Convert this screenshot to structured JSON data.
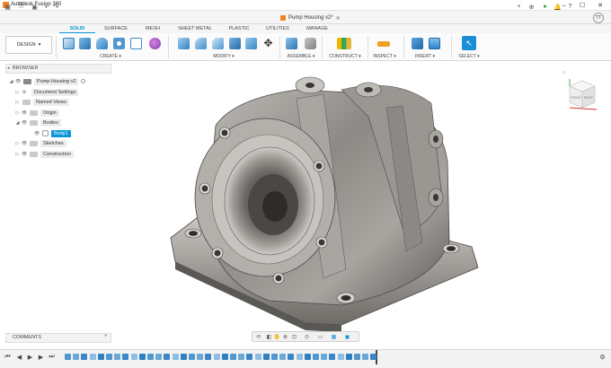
{
  "app": {
    "title": "Autodesk Fusion 360"
  },
  "document": {
    "tab_title": "Pump Housing v2*"
  },
  "user": {
    "initials": "TT"
  },
  "workspace": {
    "label": "DESIGN"
  },
  "tabs": [
    {
      "label": "SOLID",
      "active": true
    },
    {
      "label": "SURFACE",
      "active": false
    },
    {
      "label": "MESH",
      "active": false
    },
    {
      "label": "SHEET METAL",
      "active": false
    },
    {
      "label": "PLASTIC",
      "active": false
    },
    {
      "label": "UTILITIES",
      "active": false
    },
    {
      "label": "MANAGE",
      "active": false
    }
  ],
  "ribbon_groups": [
    {
      "label": "CREATE ▾"
    },
    {
      "label": "MODIFY ▾"
    },
    {
      "label": "ASSEMBLE ▾"
    },
    {
      "label": "CONSTRUCT ▾"
    },
    {
      "label": "INSPECT ▾"
    },
    {
      "label": "INSERT ▾"
    },
    {
      "label": "SELECT ▾"
    }
  ],
  "browser": {
    "title": "BROWSER",
    "items": [
      {
        "label": "Pump Housing v2"
      },
      {
        "label": "Document Settings"
      },
      {
        "label": "Named Views"
      },
      {
        "label": "Origin"
      },
      {
        "label": "Bodies"
      },
      {
        "label": "Body1"
      },
      {
        "label": "Sketches"
      },
      {
        "label": "Construction"
      }
    ]
  },
  "comments": {
    "title": "COMMENTS"
  },
  "viewcube": {
    "front": "FRONT",
    "right": "RIGHT"
  },
  "colors": {
    "accent": "#0696d7",
    "ribbon_bg": "#fbfbfb",
    "timeline_bg": "#f3f3f3"
  }
}
